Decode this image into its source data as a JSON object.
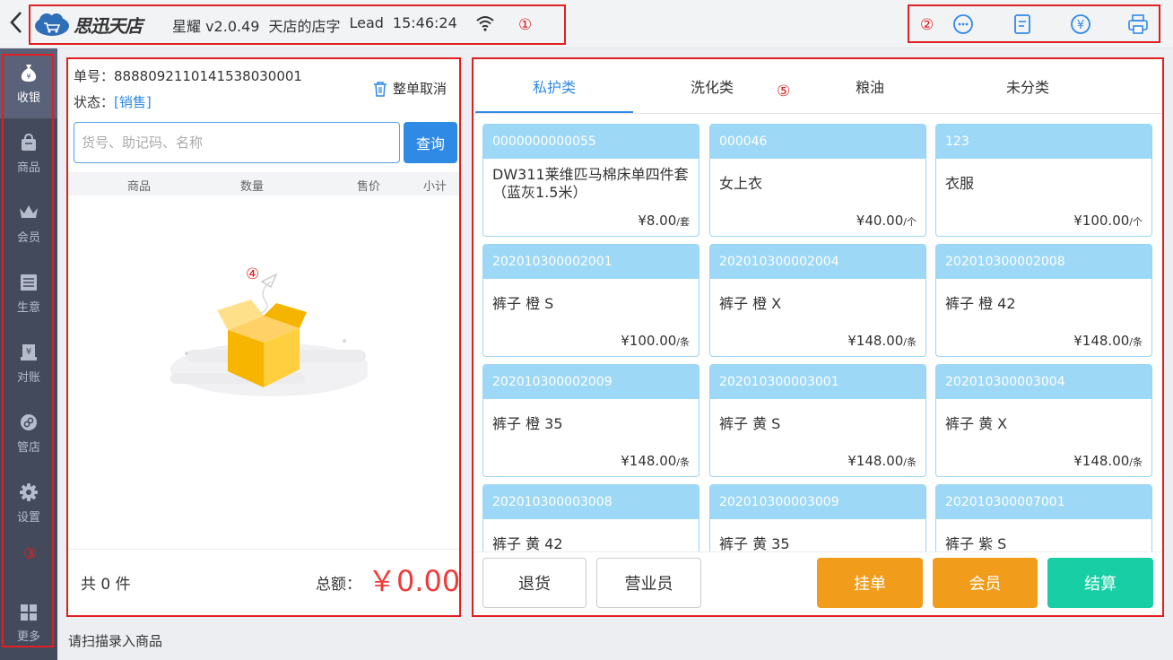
{
  "header": {
    "brand": "思迅天店",
    "version": "星耀 v2.0.49",
    "store_name": "天店的店字",
    "user": "Lead",
    "time": "15:46:24",
    "mark1": "①",
    "mark2": "②"
  },
  "top_icons": [
    "chat-icon",
    "document-icon",
    "yuan-icon",
    "printer-icon"
  ],
  "sidebar": {
    "items": [
      {
        "label": "收银",
        "icon": "money-bag-icon",
        "active": true
      },
      {
        "label": "商品",
        "icon": "bag-icon"
      },
      {
        "label": "会员",
        "icon": "crown-icon"
      },
      {
        "label": "生意",
        "icon": "register-icon"
      },
      {
        "label": "对账",
        "icon": "reconcile-icon"
      },
      {
        "label": "管店",
        "icon": "store-icon"
      },
      {
        "label": "设置",
        "icon": "gear-icon"
      },
      {
        "label": "更多",
        "icon": "grid-icon"
      }
    ],
    "mark": "③"
  },
  "order": {
    "number_label": "单号：",
    "number": "8888092110141538030001",
    "status_label": "状态：",
    "status": "[销售]",
    "cancel_label": "整单取消",
    "search_placeholder": "货号、助记码、名称",
    "search_button": "查询",
    "columns": [
      "商品",
      "数量",
      "售价",
      "小计"
    ],
    "mark": "④",
    "count_text": "共 0 件",
    "total_label": "总额：",
    "total": "￥0.00"
  },
  "products": {
    "tabs": [
      "私护类",
      "洗化类",
      "粮油",
      "未分类"
    ],
    "active_tab": 0,
    "mark": "⑤",
    "items": [
      {
        "code": "0000000000055",
        "name": "DW311莱维匹马棉床单四件套（蓝灰1.5米）",
        "price": "¥8.00",
        "unit": "/套"
      },
      {
        "code": "000046",
        "name": "女上衣",
        "price": "¥40.00",
        "unit": "/个"
      },
      {
        "code": "123",
        "name": "衣服",
        "price": "¥100.00",
        "unit": "/个"
      },
      {
        "code": "202010300002001",
        "name": "裤子 橙 S",
        "price": "¥100.00",
        "unit": "/条"
      },
      {
        "code": "202010300002004",
        "name": "裤子 橙 X",
        "price": "¥148.00",
        "unit": "/条"
      },
      {
        "code": "202010300002008",
        "name": "裤子 橙 42",
        "price": "¥148.00",
        "unit": "/条"
      },
      {
        "code": "202010300002009",
        "name": "裤子 橙 35",
        "price": "¥148.00",
        "unit": "/条"
      },
      {
        "code": "202010300003001",
        "name": "裤子 黄 S",
        "price": "¥148.00",
        "unit": "/条"
      },
      {
        "code": "202010300003004",
        "name": "裤子 黄 X",
        "price": "¥148.00",
        "unit": "/条"
      },
      {
        "code": "202010300003008",
        "name": "裤子 黄 42",
        "price": "",
        "unit": ""
      },
      {
        "code": "202010300003009",
        "name": "裤子 黄 35",
        "price": "",
        "unit": ""
      },
      {
        "code": "202010300007001",
        "name": "裤子 紫 S",
        "price": "",
        "unit": ""
      }
    ]
  },
  "actions": {
    "return": "退货",
    "staff": "营业员",
    "hold": "挂单",
    "member": "会员",
    "checkout": "结算"
  },
  "status_bar": "请扫描录入商品",
  "colors": {
    "accent": "#2f8ae6",
    "sidebar": "#434a5c",
    "card_header": "#9dd8f7",
    "orange": "#f29c1c",
    "teal": "#18cfa5",
    "total": "#f03b3b",
    "annotation": "#e02020"
  }
}
